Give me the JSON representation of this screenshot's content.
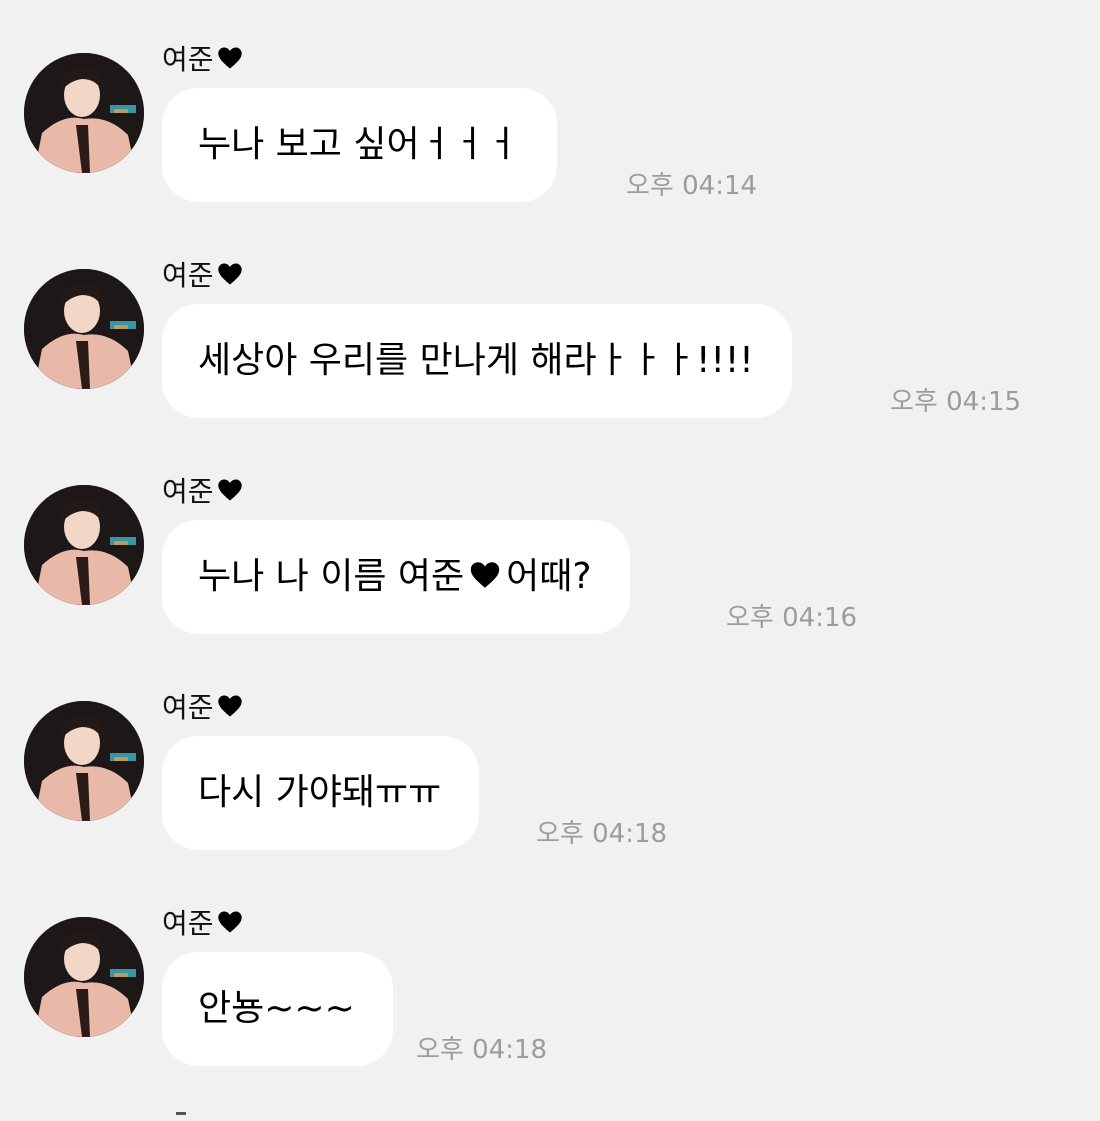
{
  "sender_name": "여준",
  "messages": [
    {
      "sender": "여준",
      "text": "누나 보고 싶어ㅓㅓㅓ",
      "time": "오후 04:14"
    },
    {
      "sender": "여준",
      "text": "세상아 우리를 만나게 해라ㅏㅏㅏ!!!!",
      "time": "오후 04:15"
    },
    {
      "sender": "여준",
      "text_before": "누나 나 이름 여준",
      "text_after": "어때?",
      "time": "오후 04:16"
    },
    {
      "sender": "여준",
      "text": "다시 가야돼ㅠㅠ",
      "time": "오후 04:18"
    },
    {
      "sender": "여준",
      "text": "안뇽~~~",
      "time": "오후 04:18"
    }
  ],
  "icons": {
    "sender_suffix": "heart-icon",
    "avatar": "avatar-photo"
  },
  "colors": {
    "background": "#f1f1f1",
    "bubble": "#ffffff",
    "text": "#000000",
    "time": "#9c9c9c"
  }
}
